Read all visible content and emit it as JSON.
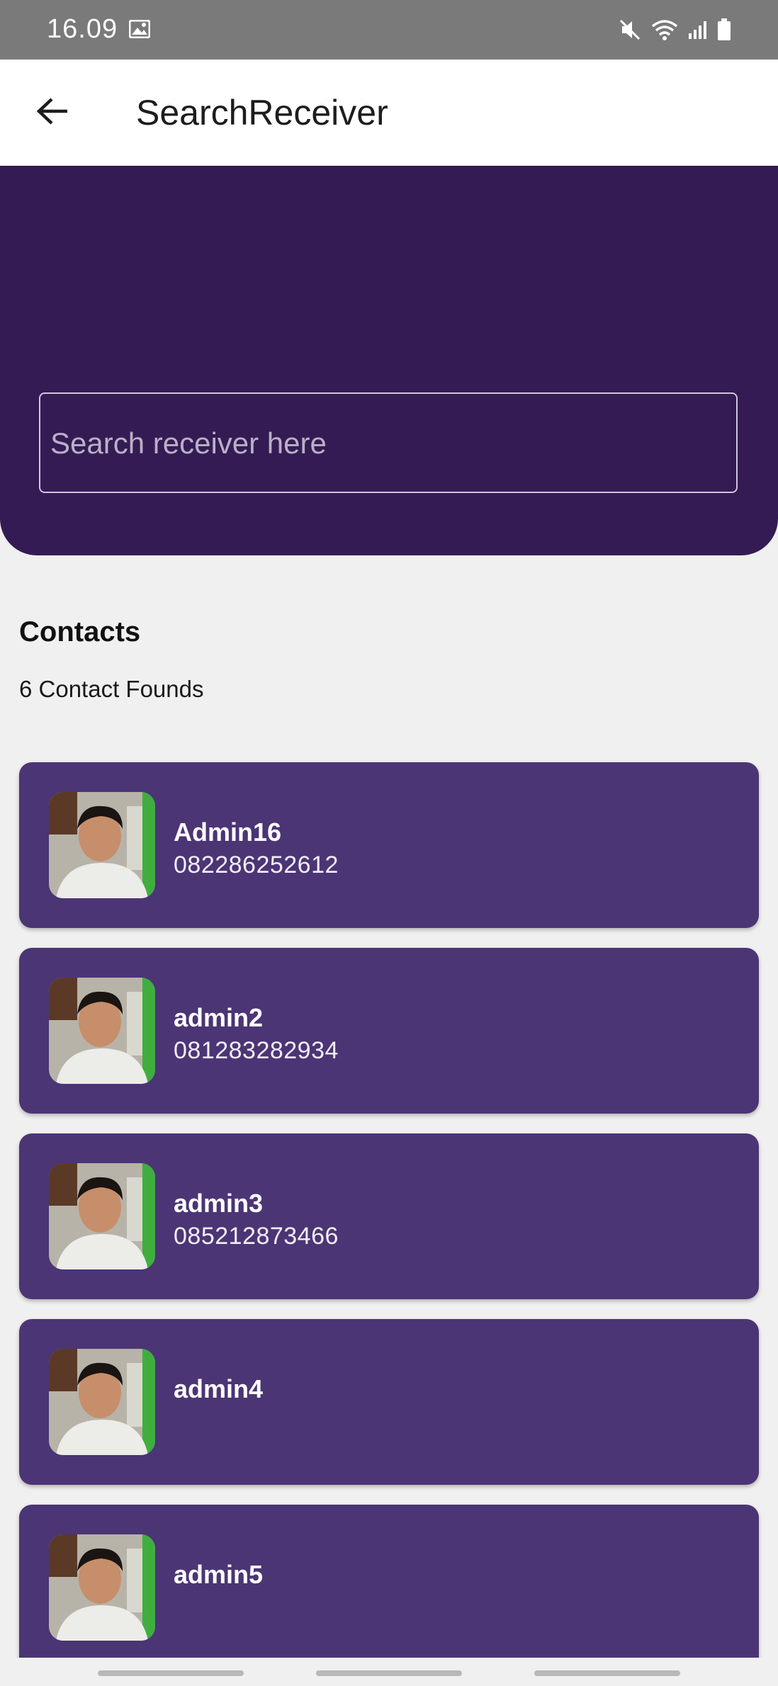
{
  "status_bar": {
    "time": "16.09",
    "icons": [
      "gallery-icon",
      "mute-icon",
      "wifi-icon",
      "signal-icon",
      "battery-icon"
    ]
  },
  "app_bar": {
    "back_icon": "back-arrow-icon",
    "title": "SearchReceiver"
  },
  "search": {
    "placeholder": "Search receiver here",
    "value": ""
  },
  "contacts": {
    "heading": "Contacts",
    "count_text": "6 Contact Founds",
    "items": [
      {
        "name": "Admin16",
        "phone": "082286252612"
      },
      {
        "name": "admin2",
        "phone": "081283282934"
      },
      {
        "name": "admin3",
        "phone": "085212873466"
      },
      {
        "name": "admin4",
        "phone": ""
      },
      {
        "name": "admin5",
        "phone": ""
      }
    ]
  },
  "colors": {
    "header_bg": "#351b54",
    "card_bg": "#4b3575",
    "page_bg": "#f0f0f0",
    "status_bar_bg": "#7a7a7a"
  }
}
